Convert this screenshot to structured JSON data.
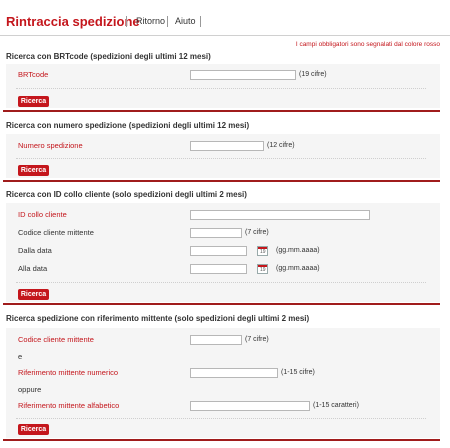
{
  "header": {
    "title": "Rintraccia spedizione",
    "nav": [
      "Ritorno",
      "Aiuto"
    ]
  },
  "required_note": "I campi obbligatori sono segnalati dal colore rosso",
  "sections": {
    "brt": {
      "title": "Ricerca con BRTcode (spedizioni degli ultimi 12 mesi)",
      "field_label": "BRTcode",
      "field_value": "",
      "hint": "(19 cifre)",
      "button": "Ricerca"
    },
    "numero": {
      "title": "Ricerca con numero spedizione (spedizioni degli ultimi 12 mesi)",
      "field_label": "Numero spedizione",
      "field_value": "",
      "hint": "(12 cifre)",
      "button": "Ricerca"
    },
    "collo": {
      "title": "Ricerca con ID collo cliente (solo spedizioni degli ultimi 2 mesi)",
      "id_label": "ID collo cliente",
      "codice_label": "Codice cliente mittente",
      "codice_hint": "(7 cifre)",
      "dalla_label": "Dalla data",
      "alla_label": "Alla data",
      "date_hint": "(gg.mm.aaaa)",
      "button": "Ricerca"
    },
    "riferimento": {
      "title": "Ricerca spedizione con riferimento mittente (solo spedizioni degli ultimi 2 mesi)",
      "codice_label": "Codice cliente mittente",
      "codice_hint": "(7 cifre)",
      "e_label": "e",
      "numerico_label": "Riferimento mittente numerico",
      "numerico_hint": "(1-15 cifre)",
      "oppure_label": "oppure",
      "alfabetico_label": "Riferimento mittente alfabetico",
      "alfabetico_hint": "(1-15 caratteri)",
      "button": "Ricerca"
    }
  },
  "colors": {
    "accent": "#c4161c",
    "divider": "#a01c1c",
    "panel": "#f5f5f5"
  }
}
